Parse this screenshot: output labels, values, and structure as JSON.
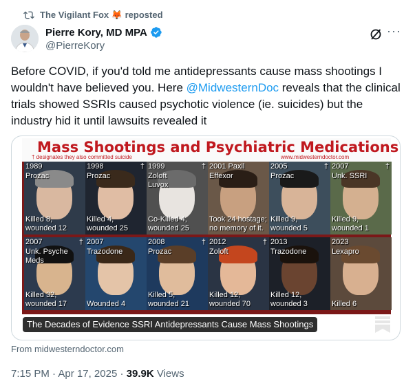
{
  "repost": {
    "name": "The Vigilant Fox",
    "emoji": "🦊",
    "suffix": "reposted",
    "icon": "repost-icon"
  },
  "author": {
    "name": "Pierre Kory, MD MPA",
    "handle": "@PierreKory",
    "verified": true,
    "accent": "#1d9bf0"
  },
  "tweet": {
    "text_before": "Before COVID, if you'd told me antidepressants cause mass shootings I wouldn't have believed you. Here ",
    "mention": "@MidwesternDoc",
    "text_after": " reveals that the clinical trials showed SSRIs caused psychotic violence (ie. suicides) but the industry hid it until lawsuits revealed it"
  },
  "media": {
    "poster_title": "Mass Shootings and Psychiatric Medications",
    "poster_note": "† designates they also committed suicide",
    "poster_url": "www.midwesterndoctor.com",
    "cards": [
      {
        "year": "1989",
        "detail": "Prozac",
        "cross": "",
        "toll": "Killed 8,\nwounded 12",
        "skin": "#d9b8a0",
        "hair": "#8a8a8a",
        "bg": "#2f3b4a"
      },
      {
        "year": "1998",
        "detail": "Prozac",
        "cross": "†",
        "toll": "Killed 4,\nwounded 25",
        "skin": "#e0bda4",
        "hair": "#3a2a1c",
        "bg": "#1f2530"
      },
      {
        "year": "1999",
        "detail": "Zoloft\nLuvox",
        "cross": "†",
        "toll": "Co-Killed 4,\nwounded 25",
        "skin": "#e8e4e0",
        "hair": "#6b6b6b",
        "bg": "#505050"
      },
      {
        "year": "2001 Paxil",
        "detail": "Effexor",
        "cross": "",
        "toll": "Took 24 hostage;\nno memory of it.",
        "skin": "#c8a080",
        "hair": "#2a1e16",
        "bg": "#6a5848"
      },
      {
        "year": "2005",
        "detail": "Prozac",
        "cross": "†",
        "toll": "Killed 9,\nwounded 5",
        "skin": "#d8b498",
        "hair": "#1a1a1a",
        "bg": "#3d4e5c"
      },
      {
        "year": "2007",
        "detail": "Unk. SSRI",
        "cross": "†",
        "toll": "Killed 9,\nwounded 1",
        "skin": "#d4b090",
        "hair": "#4a3626",
        "bg": "#5a6a4a"
      },
      {
        "year": "2007",
        "detail": "Unk. Psyche\nMeds",
        "cross": "†",
        "toll": "Killed 32,\nwounded 17",
        "skin": "#d8b48e",
        "hair": "#111111",
        "bg": "#2c3a4e"
      },
      {
        "year": "2007",
        "detail": "Trazodone",
        "cross": "",
        "toll": "Wounded 4",
        "skin": "#e4c4a8",
        "hair": "#3a2818",
        "bg": "#24476e"
      },
      {
        "year": "2008",
        "detail": "Prozac",
        "cross": "†",
        "toll": "Killed 5,\nwounded 21",
        "skin": "#e0bc9c",
        "hair": "#5a3e28",
        "bg": "#1e3a5e"
      },
      {
        "year": "2012",
        "detail": "Zoloft",
        "cross": "†",
        "toll": "Killed 12,\nwounded 70",
        "skin": "#e4b898",
        "hair": "#c4461e",
        "bg": "#2a3444"
      },
      {
        "year": "2013",
        "detail": "Trazodone",
        "cross": "",
        "toll": "Killed 12,\nwounded 3",
        "skin": "#6a4430",
        "hair": "#1a120c",
        "bg": "#1c2028"
      },
      {
        "year": "2023",
        "detail": "Lexapro",
        "cross": "",
        "toll": "Killed 6",
        "skin": "#d8b090",
        "hair": "#6a4a30",
        "bg": "#5c4a3c"
      }
    ],
    "caption": "The Decades of Evidence SSRI Antidepressants Cause Mass Shootings",
    "bookmark_icon": "bookmark-icon"
  },
  "source": "From midwesterndoctor.com",
  "meta": {
    "time": "7:15 PM",
    "separator": " · ",
    "date": "Apr 17, 2025",
    "views_count": "39.9K",
    "views_label": " Views"
  },
  "icons": {
    "grok": "grok-icon",
    "more": "more-icon",
    "verified": "verified-badge-icon"
  }
}
